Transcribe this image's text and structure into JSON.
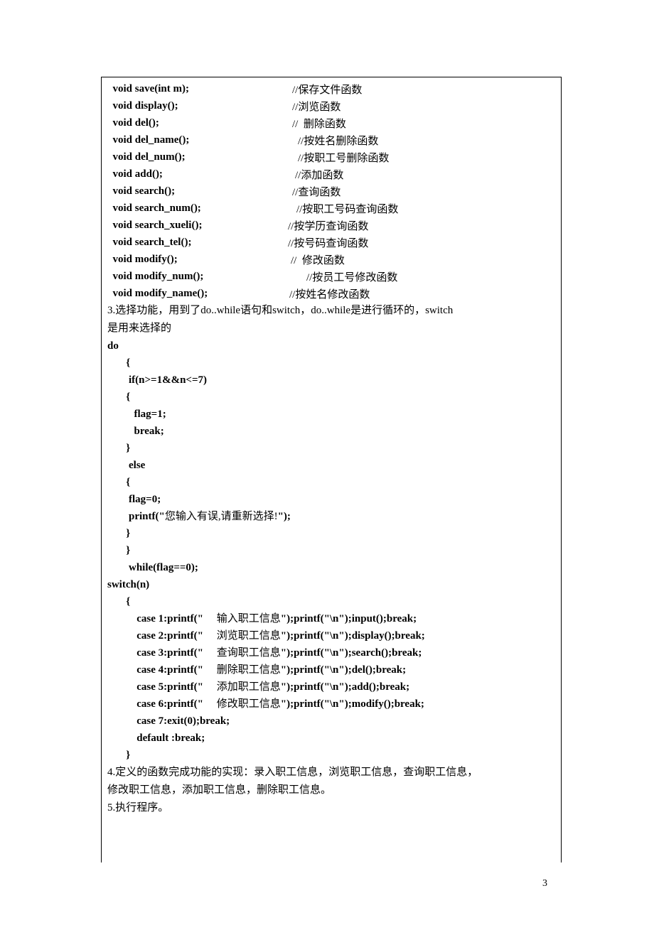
{
  "funcs": [
    {
      "code": "  void save(int m);",
      "pad": 260,
      "cmt": "//保存文件函数"
    },
    {
      "code": "  void display();",
      "pad": 260,
      "cmt": "//浏览函数"
    },
    {
      "code": "  void del();",
      "pad": 260,
      "cmt": "//  删除函数"
    },
    {
      "code": "  void del_name();",
      "pad": 268,
      "cmt": "//按姓名删除函数"
    },
    {
      "code": "  void del_num();",
      "pad": 268,
      "cmt": "//按职工号删除函数"
    },
    {
      "code": "  void add();",
      "pad": 264,
      "cmt": "//添加函数"
    },
    {
      "code": "  void search();",
      "pad": 260,
      "cmt": "//查询函数"
    },
    {
      "code": "  void search_num();",
      "pad": 266,
      "cmt": "//按职工号码查询函数"
    },
    {
      "code": "  void search_xueli();",
      "pad": 254,
      "cmt": "//按学历查询函数"
    },
    {
      "code": "  void search_tel();",
      "pad": 254,
      "cmt": "//按号码查询函数"
    },
    {
      "code": "  void modify();",
      "pad": 258,
      "cmt": "//  修改函数"
    },
    {
      "code": "  void modify_num();",
      "pad": 280,
      "cmt": "//按员工号修改函数"
    },
    {
      "code": "  void modify_name();",
      "pad": 256,
      "cmt": "//按姓名修改函数"
    }
  ],
  "para3a": "3.选择功能，用到了do..while语句和switch，do..while是进行循环的，switch",
  "para3b": "是用来选择的",
  "doBlock": [
    "do",
    "       {",
    "        if(n>=1&&n<=7)",
    "       {",
    "          flag=1;",
    "          break;",
    "       }",
    "        else",
    "       {",
    "        flag=0;",
    "        printf(\"您输入有误,请重新选择!\");",
    "       }",
    "       }",
    "        while(flag==0);",
    "switch(n)",
    "       {"
  ],
  "cases": [
    {
      "pre": "           case 1:printf(\"     ",
      "cn": "输入职工信息",
      "post": "\");printf(\"\\n\");input();break;"
    },
    {
      "pre": "           case 2:printf(\"     ",
      "cn": "浏览职工信息",
      "post": "\");printf(\"\\n\");display();break;"
    },
    {
      "pre": "           case 3:printf(\"     ",
      "cn": "查询职工信息",
      "post": "\");printf(\"\\n\");search();break;"
    },
    {
      "pre": "           case 4:printf(\"     ",
      "cn": "删除职工信息",
      "post": "\");printf(\"\\n\");del();break;"
    },
    {
      "pre": "           case 5:printf(\"     ",
      "cn": "添加职工信息",
      "post": "\");printf(\"\\n\");add();break;"
    },
    {
      "pre": "           case 6:printf(\"     ",
      "cn": "修改职工信息",
      "post": "\");printf(\"\\n\");modify();break;"
    }
  ],
  "casesTail": [
    "           case 7:exit(0);break;",
    "           default :break;",
    "       }"
  ],
  "para4a": "4.定义的函数完成功能的实现：录入职工信息，浏览职工信息，查询职工信息，",
  "para4b": "修改职工信息，添加职工信息，删除职工信息。",
  "para5": "5.执行程序。",
  "pageNum": "3"
}
